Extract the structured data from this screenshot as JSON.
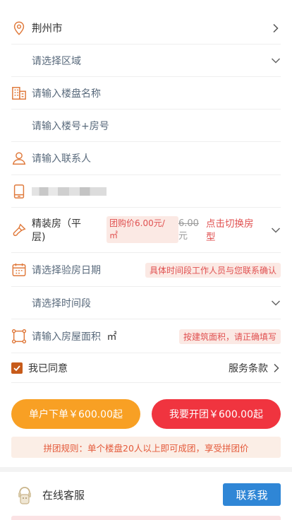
{
  "form": {
    "city": "荆州市",
    "district_placeholder": "请选择区域",
    "building_placeholder": "请输入楼盘名称",
    "room_placeholder": "请输入楼号+房号",
    "contact_placeholder": "请输入联系人",
    "house_type_line1": "精装房（平",
    "house_type_line2": "层)",
    "group_price_line1": "团购价6.00元/",
    "group_price_line2": "㎡",
    "original_price_line1": "6.00",
    "original_price_line2": "元",
    "switch_line1": "点击切换房",
    "switch_line2": "型",
    "date_placeholder": "请选择验房日期",
    "date_hint": "具体时间段工作人员与您联系确认",
    "time_placeholder": "请选择时间段",
    "area_placeholder": "请输入房屋面积",
    "area_unit": "㎡",
    "area_hint": "按建筑面积，请正确填写",
    "agree_label": "我已同意",
    "terms_label": "服务条款"
  },
  "actions": {
    "single_order": "单户下单￥600.00起",
    "group_order": "我要开团￥600.00起"
  },
  "rules_text": "拼团规则：单个楼盘20人以上即可成团，享受拼团价",
  "service": {
    "label": "在线客服",
    "contact_button": "联系我"
  },
  "colors": {
    "icon_orange": "#e07a3c",
    "single_btn": "#f8a024",
    "group_btn": "#f0343f",
    "contact_btn": "#2f86d6",
    "hint_bg": "#fbe9e4",
    "hint_text": "#e05050"
  },
  "icons": [
    "location-icon",
    "building-icon",
    "person-icon",
    "phone-icon",
    "brush-icon",
    "calendar-icon",
    "area-icon",
    "chevron-right-icon",
    "chevron-down-icon",
    "checkbox-check-icon",
    "customer-service-icon"
  ]
}
